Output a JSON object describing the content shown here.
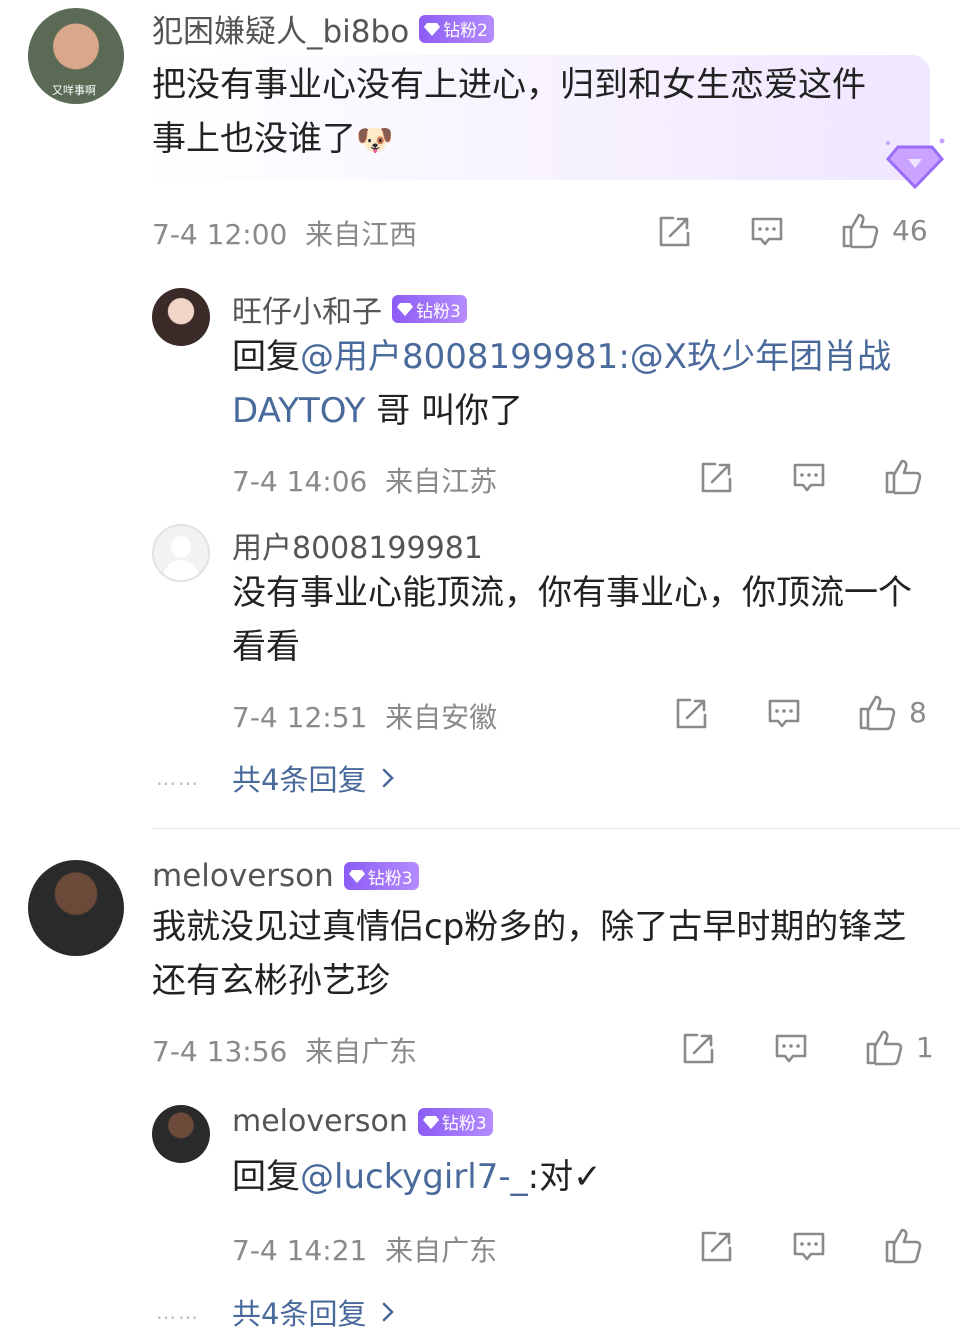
{
  "comments": [
    {
      "user": "犯困嫌疑人_bi8bo",
      "badge": "钻粉2",
      "avatar_caption": "又咩事啊",
      "text": "把没有事业心没有上进心，归到和女生恋爱这件事上也没谁了",
      "emoji": "🐶",
      "time": "7-4 12:00",
      "location": "来自江西",
      "likes": "46",
      "replies": [
        {
          "user": "旺仔小和子",
          "badge": "钻粉3",
          "reply_prefix": "回复",
          "mention": "@用户8008199981:@X玖少年团肖战DAYTOY",
          "text": " 哥 叫你了",
          "time": "7-4 14:06",
          "location": "来自江苏",
          "likes": ""
        },
        {
          "user": "用户8008199981",
          "text": "没有事业心能顶流，你有事业心，你顶流一个看看",
          "time": "7-4 12:51",
          "location": "来自安徽",
          "likes": "8"
        }
      ],
      "more_replies": "共4条回复",
      "more_dots": "……"
    },
    {
      "user": "meloverson",
      "badge": "钻粉3",
      "text": "我就没见过真情侣cp粉多的，除了古早时期的锋芝还有玄彬孙艺珍",
      "time": "7-4 13:56",
      "location": "来自广东",
      "likes": "1",
      "replies": [
        {
          "user": "meloverson",
          "badge": "钻粉3",
          "reply_prefix": "回复",
          "mention": "@luckygirl7-_",
          "text": ":对✓",
          "time": "7-4 14:21",
          "location": "来自广东",
          "likes": ""
        }
      ],
      "more_replies": "共4条回复",
      "more_dots": "……"
    }
  ],
  "icons": {
    "share": "share-icon",
    "comment": "comment-icon",
    "like": "thumbs-up-icon",
    "chevron": "chevron-right-icon"
  },
  "colors": {
    "badge": "#9b6cf7",
    "link": "#4a6a9b",
    "meta": "#8a8a8a"
  }
}
